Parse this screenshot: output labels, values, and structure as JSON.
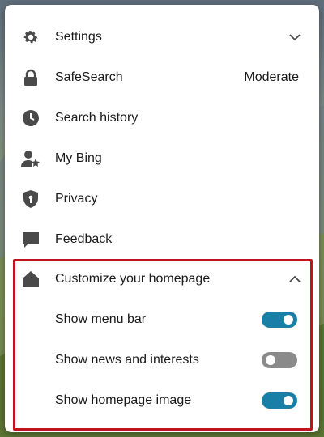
{
  "colors": {
    "accent": "#1a7fa6",
    "toggle_off": "#8a8a8a",
    "highlight": "#c1121f",
    "icon": "#4a4a4a"
  },
  "menu": {
    "items": [
      {
        "label": "Settings",
        "icon": "gear-icon",
        "expand": "chevron-down-icon"
      },
      {
        "label": "SafeSearch",
        "icon": "lock-icon",
        "value": "Moderate"
      },
      {
        "label": "Search history",
        "icon": "clock-icon"
      },
      {
        "label": "My Bing",
        "icon": "person-star-icon"
      },
      {
        "label": "Privacy",
        "icon": "shield-icon"
      },
      {
        "label": "Feedback",
        "icon": "chat-bubble-icon"
      }
    ]
  },
  "customize": {
    "label": "Customize your homepage",
    "icon": "home-icon",
    "expand": "chevron-up-icon",
    "options": [
      {
        "label": "Show menu bar",
        "enabled": true
      },
      {
        "label": "Show news and interests",
        "enabled": false
      },
      {
        "label": "Show homepage image",
        "enabled": true
      }
    ]
  }
}
